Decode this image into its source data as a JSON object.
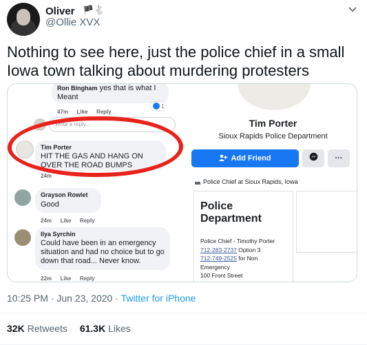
{
  "tweet": {
    "name": "Oliver",
    "handle": "@Ollie XVX",
    "name_emoji": "🏴🐇",
    "text": "Nothing to see here, just the police chief in a small Iowa town talking about murdering protesters",
    "timestamp": "10:25 PM · Jun 23, 2020 · ",
    "source": "Twitter for iPhone",
    "retweets_count": "32K",
    "retweets_label": "Retweets",
    "likes_count": "61.3K",
    "likes_label": "Likes"
  },
  "facebook": {
    "comments": [
      {
        "name": "Ron Bingham",
        "text": "yes that is what I Meant",
        "time": "47m",
        "like": "Like",
        "reply": "Reply",
        "reaction_count": "1"
      },
      {
        "name": "Tim Porter",
        "text": "HIT THE GAS AND HANG ON OVER THE ROAD BUMPS",
        "time": "24m"
      },
      {
        "name": "Grayson Rowlet",
        "text": "Good",
        "time": "24m",
        "like": "Like",
        "reply": "Reply"
      },
      {
        "name": "Ilya Syrchin",
        "text": "Could have been in an emergency situation and had no choice but to go down that road... Never know.",
        "time": "22m",
        "like": "Like",
        "reply": "Reply"
      }
    ],
    "reply_placeholder": "Write a reply...",
    "profile": {
      "name": "Tim Porter",
      "subtitle": "Sioux Rapids Police Department",
      "add_friend": "Add Friend",
      "more": "···",
      "cut_line": "Police Chief at Sioux Rapids, Iowa"
    },
    "pd_card": {
      "title": "Police Department",
      "line1": "Police Chief - Timothy Porter",
      "phone1": "712-283-2737",
      "line2_suffix": " Option 3",
      "phone2": "712-749-2525",
      "line3_suffix": " for Non",
      "line4": "Emergency",
      "line5": "100 Front Street"
    }
  }
}
